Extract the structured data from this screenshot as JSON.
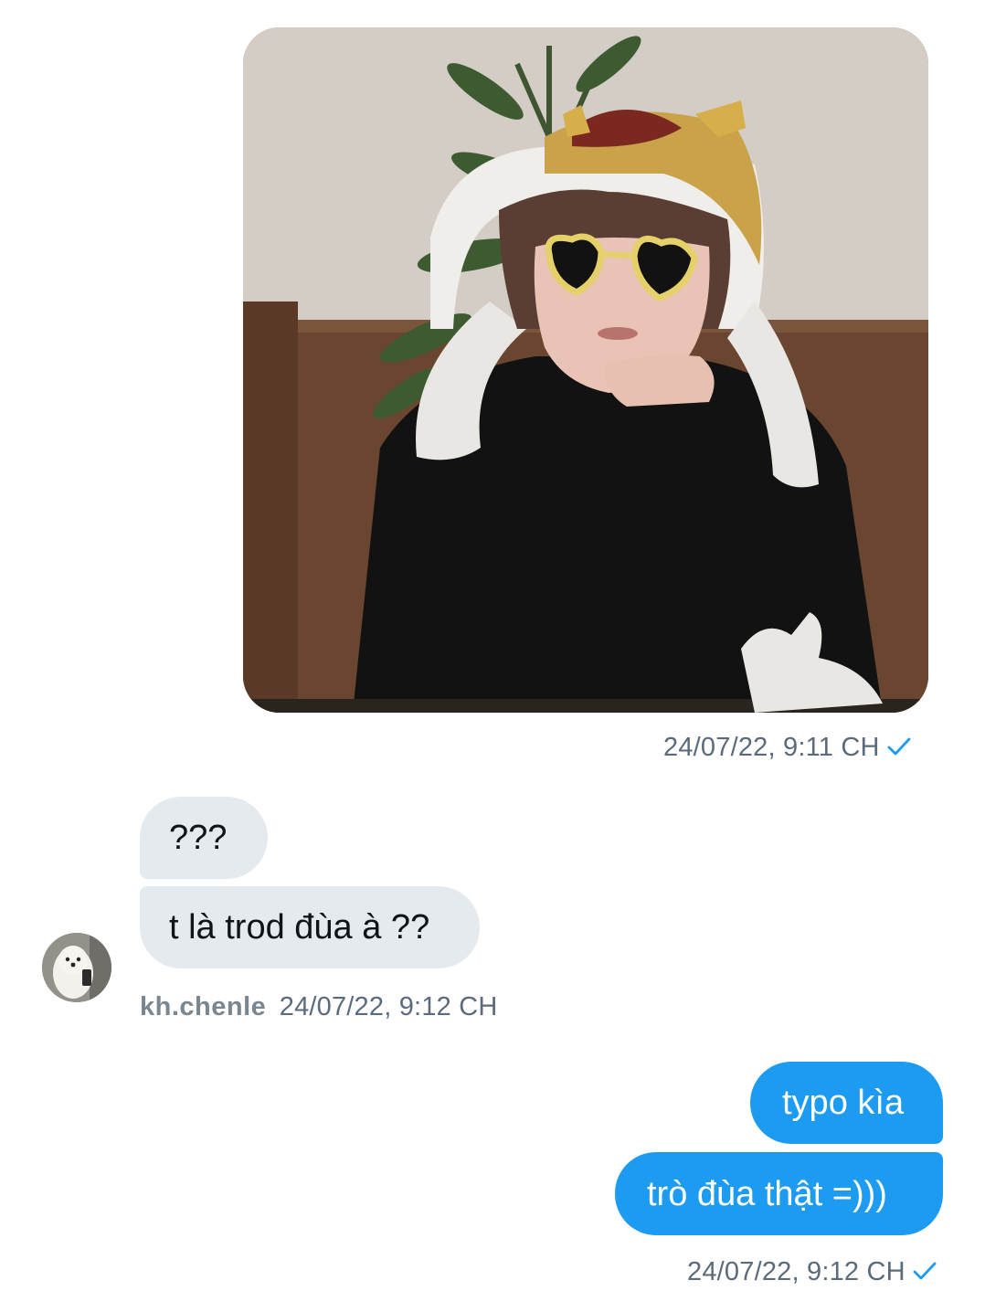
{
  "conversation": {
    "sent_image": {
      "alt": "sent photo",
      "meta": "24/07/22, 9:11 CH"
    },
    "incoming": {
      "messages": [
        "???",
        "t là trod đùa à ??"
      ],
      "sender": "kh.chenle",
      "meta": "24/07/22, 9:12 CH"
    },
    "outgoing": {
      "messages": [
        "typo kìa",
        "trò đùa thật =)))"
      ],
      "meta": "24/07/22, 9:12 CH"
    }
  },
  "colors": {
    "outgoing_bubble": "#1d9bf0",
    "incoming_bubble": "#e5eaee",
    "meta_text": "#5b6b7b",
    "check": "#1d9bf0"
  },
  "icons": {
    "read_receipt": "check-icon",
    "avatar": "dog-avatar"
  }
}
